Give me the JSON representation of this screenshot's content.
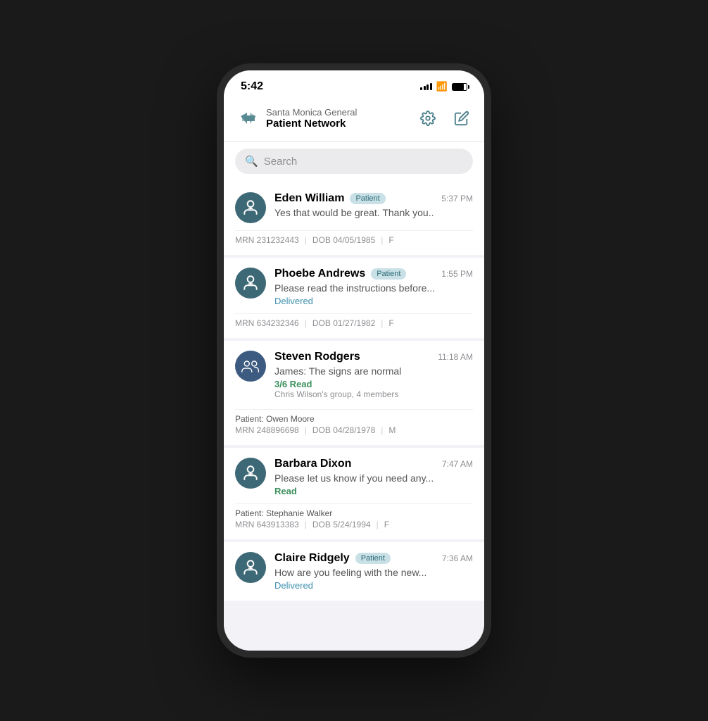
{
  "statusBar": {
    "time": "5:42",
    "signalBars": [
      4,
      6,
      8,
      10,
      12
    ],
    "wifi": "wifi",
    "battery": 80
  },
  "header": {
    "networkName": "Santa Monica General",
    "networkBold": "Patient Network",
    "backLabel": "back",
    "settingsLabel": "settings",
    "composeLabel": "compose"
  },
  "search": {
    "placeholder": "Search"
  },
  "conversations": [
    {
      "id": "eden-william",
      "name": "Eden William",
      "badge": "Patient",
      "time": "5:37 PM",
      "preview": "Yes that would be great. Thank you..",
      "status": null,
      "statusText": null,
      "groupInfo": null,
      "patientLabel": null,
      "mrn": "231232443",
      "dob": "04/05/1985",
      "gender": "F",
      "avatarType": "person"
    },
    {
      "id": "phoebe-andrews",
      "name": "Phoebe Andrews",
      "badge": "Patient",
      "time": "1:55 PM",
      "preview": "Please read the instructions before...",
      "status": "delivered",
      "statusText": "Delivered",
      "groupInfo": null,
      "patientLabel": null,
      "mrn": "634232346",
      "dob": "01/27/1982",
      "gender": "F",
      "avatarType": "person"
    },
    {
      "id": "steven-rodgers",
      "name": "Steven Rodgers",
      "badge": null,
      "time": "11:18 AM",
      "preview": "James: The signs are normal",
      "status": "read-fraction",
      "statusText": "3/6 Read",
      "groupInfo": "Chris Wilson's group, 4 members",
      "patientLabel": "Patient: Owen Moore",
      "mrn": "248896698",
      "dob": "04/28/1978",
      "gender": "M",
      "avatarType": "group"
    },
    {
      "id": "barbara-dixon",
      "name": "Barbara Dixon",
      "badge": null,
      "time": "7:47 AM",
      "preview": "Please let us know if you need any...",
      "status": "read",
      "statusText": "Read",
      "groupInfo": null,
      "patientLabel": "Patient: Stephanie Walker",
      "mrn": "643913383",
      "dob": "5/24/1994",
      "gender": "F",
      "avatarType": "person"
    },
    {
      "id": "claire-ridgely",
      "name": "Claire Ridgely",
      "badge": "Patient",
      "time": "7:36 AM",
      "preview": "How are you feeling with the new...",
      "status": "delivered",
      "statusText": "Delivered",
      "groupInfo": null,
      "patientLabel": null,
      "mrn": null,
      "dob": null,
      "gender": null,
      "avatarType": "person"
    }
  ]
}
